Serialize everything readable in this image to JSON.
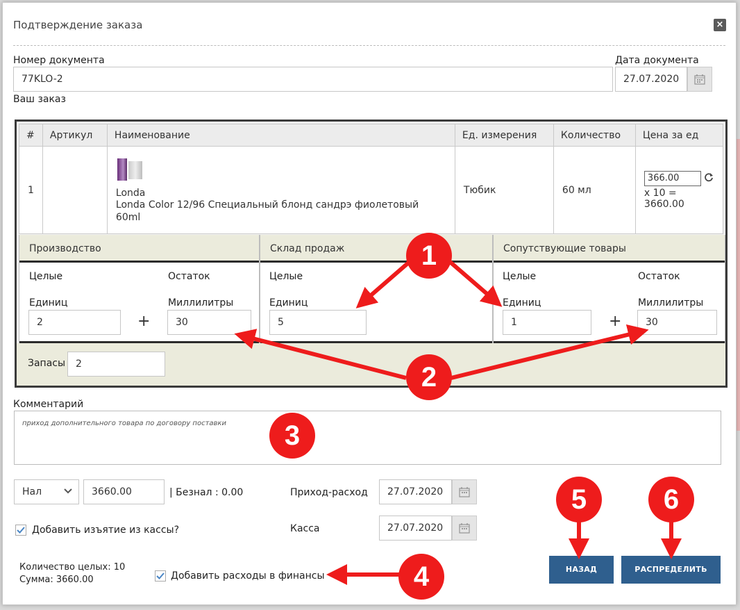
{
  "dialog": {
    "title": "Подтверждение заказа",
    "close_icon": "×"
  },
  "document": {
    "number_label": "Номер документа",
    "number_value": "77KLO-2",
    "date_label": "Дата документа",
    "date_value": "27.07.2020"
  },
  "order_label": "Ваш заказ",
  "table": {
    "headers": [
      "#",
      "Артикул",
      "Наименование",
      "Ед. измерения",
      "Количество",
      "Цена за ед"
    ],
    "row": {
      "index": "1",
      "article": "",
      "brand": "Londa",
      "name": "Londa Color 12/96 Специальный блонд сандрэ фиолетовый 60ml",
      "unit": "Тюбик",
      "quantity": "60 мл",
      "price": "366.00",
      "total": "x 10 = 3660.00"
    }
  },
  "sections": {
    "production": {
      "title": "Производство",
      "whole_label": "Целые",
      "rest_label": "Остаток",
      "units_label": "Единиц",
      "ml_label": "Миллилитры",
      "units_value": "2",
      "ml_value": "30",
      "plus": "+"
    },
    "sales": {
      "title": "Склад продаж",
      "whole_label": "Целые",
      "units_label": "Единиц",
      "units_value": "5"
    },
    "related": {
      "title": "Сопутствующие товары",
      "whole_label": "Целые",
      "rest_label": "Остаток",
      "units_label": "Единиц",
      "ml_label": "Миллилитры",
      "units_value": "1",
      "ml_value": "30",
      "plus": "+"
    },
    "stock": {
      "label": "Запасы",
      "value": "2"
    }
  },
  "comment": {
    "label": "Комментарий",
    "value": "приход дополнительного товара по договору поставки"
  },
  "payment": {
    "method": "Нал",
    "amount": "3660.00",
    "cashless": "| Безнал : 0.00",
    "income_label": "Приход-расход",
    "income_date": "27.07.2020",
    "cash_label": "Касса",
    "cash_date": "27.07.2020",
    "withdraw_label": "Добавить изъятие из кассы?",
    "withdraw_checked": true
  },
  "summary": {
    "count": "Количество целых: 10",
    "sum": "Сумма: 3660.00",
    "expenses_label": "Добавить расходы в финансы",
    "expenses_checked": true
  },
  "buttons": {
    "back": "НАЗАД",
    "distribute": "РАСПРЕДЕЛИТЬ"
  },
  "annotations": [
    "1",
    "2",
    "3",
    "4",
    "5",
    "6"
  ],
  "colors": {
    "annotation": "#ee1c1c",
    "button": "#2f5f8e",
    "section_header": "#ebebdc"
  },
  "icons": [
    "close-icon",
    "calendar-icon",
    "refresh-icon",
    "chevron-down-icon",
    "checkmark-icon"
  ]
}
